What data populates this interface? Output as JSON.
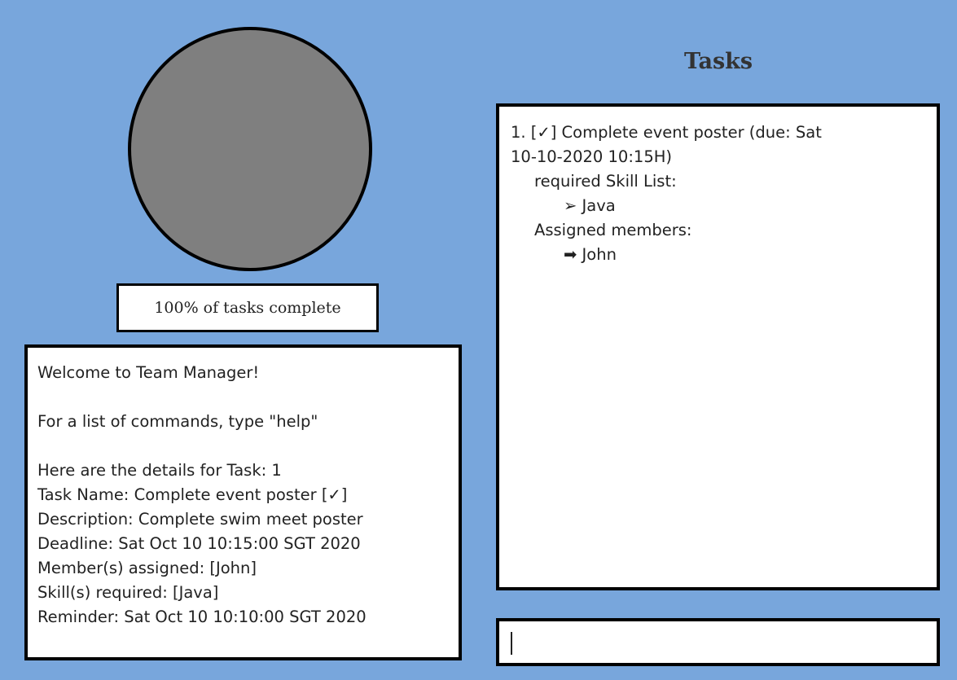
{
  "progress": {
    "fraction": 1.0,
    "label": "100% of tasks complete"
  },
  "result_display": {
    "lines": [
      "Welcome to Team Manager!",
      "",
      "For a list of commands, type \"help\"",
      "",
      "Here are the details for Task: 1",
      "Task Name: Complete event poster [✓]",
      "Description: Complete swim meet poster",
      "Deadline: Sat Oct 10 10:15:00 SGT 2020",
      "Member(s) assigned: [John]",
      "Skill(s) required: [Java]",
      "Reminder: Sat Oct 10 10:10:00 SGT 2020"
    ]
  },
  "tasks_panel": {
    "title": "Tasks",
    "items": [
      {
        "header_line1": "1. [✓] Complete event poster (due: Sat",
        "header_line2": "10-10-2020 10:15H)",
        "skills_label": "required Skill List:",
        "skills": [
          "➢ Java"
        ],
        "members_label": "Assigned members:",
        "members": [
          "➡ John"
        ]
      }
    ]
  },
  "command_box": {
    "value": "",
    "placeholder": ""
  },
  "colors": {
    "background": "#78a6dc",
    "progress_fill": "#7f7f7f"
  }
}
